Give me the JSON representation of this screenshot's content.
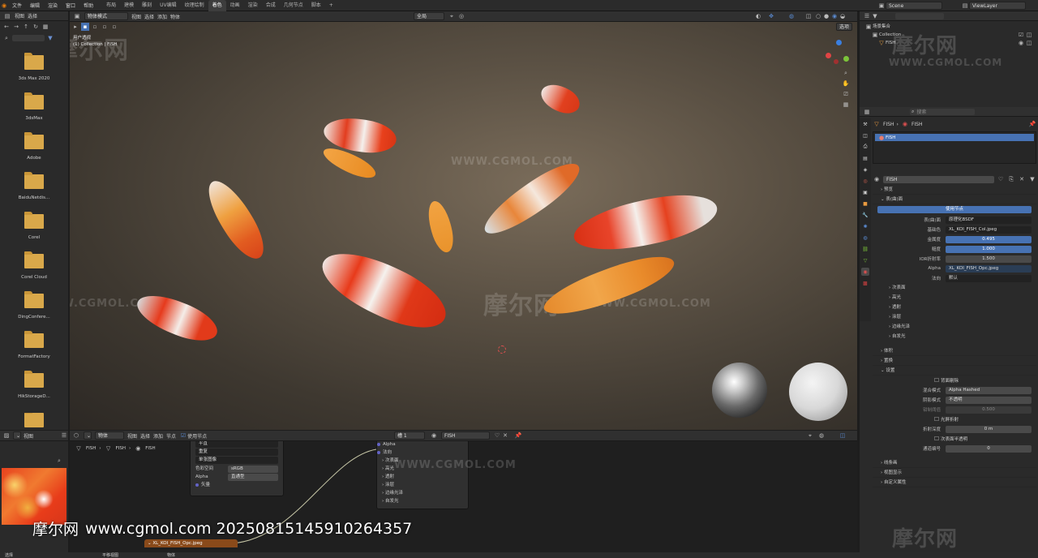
{
  "menu": {
    "items": [
      "文件",
      "编辑",
      "渲染",
      "窗口",
      "帮助"
    ]
  },
  "workspaces": {
    "tabs": [
      "布局",
      "建模",
      "雕刻",
      "UV编辑",
      "纹理绘制",
      "着色",
      "动画",
      "渲染",
      "合成",
      "几何节点",
      "脚本"
    ],
    "active_index": 5
  },
  "scene": {
    "scene_name": "Scene",
    "view_layer": "ViewLayer"
  },
  "file_browser": {
    "menu_view": "视图",
    "menu_select": "选择",
    "folders": [
      "3ds Max 2020",
      "3dsMax",
      "Adobe",
      "BaiduNetdis...",
      "Corel",
      "Corel Cloud",
      "DingConfere...",
      "FormatFactory",
      "HikStorageD...",
      ""
    ]
  },
  "viewport": {
    "mode": "物体模式",
    "menus": [
      "视图",
      "选择",
      "添加",
      "物体"
    ],
    "orientation": "全局",
    "select_label": "选项",
    "info_line1": "用户透视",
    "info_line2": "(1) Collection | FISH"
  },
  "outliner": {
    "title": "场景集合",
    "collection": "Collection",
    "object": "FISH"
  },
  "properties": {
    "search_placeholder": "搜索",
    "breadcrumb": [
      "FISH",
      "FISH"
    ],
    "slot_name": "FISH",
    "material_name": "FISH",
    "sections": {
      "preview": "预览",
      "surface": "表(曲)面",
      "volume": "体积",
      "displacement": "置换",
      "settings": "设置",
      "line_art": "线条画",
      "viewport_display": "视图显示",
      "custom_props": "自定义属性"
    },
    "use_nodes": "使用节点",
    "surface_label": "表(曲)面",
    "surface_value": "原理化BSDF",
    "base_color_label": "基础色",
    "base_color_value": "XL_KOI_FISH_Col.jpeg",
    "metallic_label": "金属度",
    "metallic_value": "0.495",
    "roughness_label": "糙度",
    "roughness_value": "1.000",
    "ior_label": "IOR折射率",
    "ior_value": "1.500",
    "alpha_label": "Alpha",
    "alpha_value": "XL_KOI_FISH_Opc.jpeg",
    "normal_label": "法向",
    "normal_value": "默认",
    "subsections": [
      "次表面",
      "高光",
      "透射",
      "涂层",
      "边缘光泽",
      "自发光"
    ],
    "settings": {
      "backface_label": "背面剔除",
      "blend_mode_label": "混合模式",
      "blend_mode_value": "Alpha Hashed",
      "shadow_mode_label": "阴影模式",
      "shadow_mode_value": "不透明",
      "clip_label": "钳制阈值",
      "clip_value": "0.500",
      "screen_refraction": "光屏折射",
      "refraction_depth_label": "折射深度",
      "refraction_depth_value": "0 m",
      "subsurface_translucency": "次表面半透明",
      "pass_index_label": "通道编号",
      "pass_index_value": "0"
    }
  },
  "node_editor": {
    "menus": [
      "视图",
      "选择",
      "添加",
      "节点"
    ],
    "object_mode": "物体",
    "use_nodes": "使用节点",
    "breadcrumb": [
      "FISH",
      "FISH",
      "FISH"
    ],
    "slot": "槽 1",
    "material": "FISH",
    "image_node_rows": [
      "平直",
      "重复",
      "单张图像"
    ],
    "color_space_label": "色彩空间",
    "color_space_value": "sRGB",
    "alpha_label": "Alpha",
    "alpha_value": "直通型",
    "vector_label": "矢量",
    "bsdf_rows": [
      "Alpha",
      "法向",
      "次表面",
      "高光",
      "透射",
      "涂层",
      "边缘光泽",
      "自发光"
    ],
    "image_name": "XL_KOI_FISH_Opc.jpeg"
  },
  "image_editor": {
    "menu_view": "视图"
  },
  "status": {
    "select": "选择",
    "pan": "平移视图",
    "object": "物体"
  },
  "watermark": {
    "brand": "摩尔网",
    "url_line": "www.cgmol.com 20250815145910264357",
    "site": "WWW.CGMOL.COM"
  }
}
